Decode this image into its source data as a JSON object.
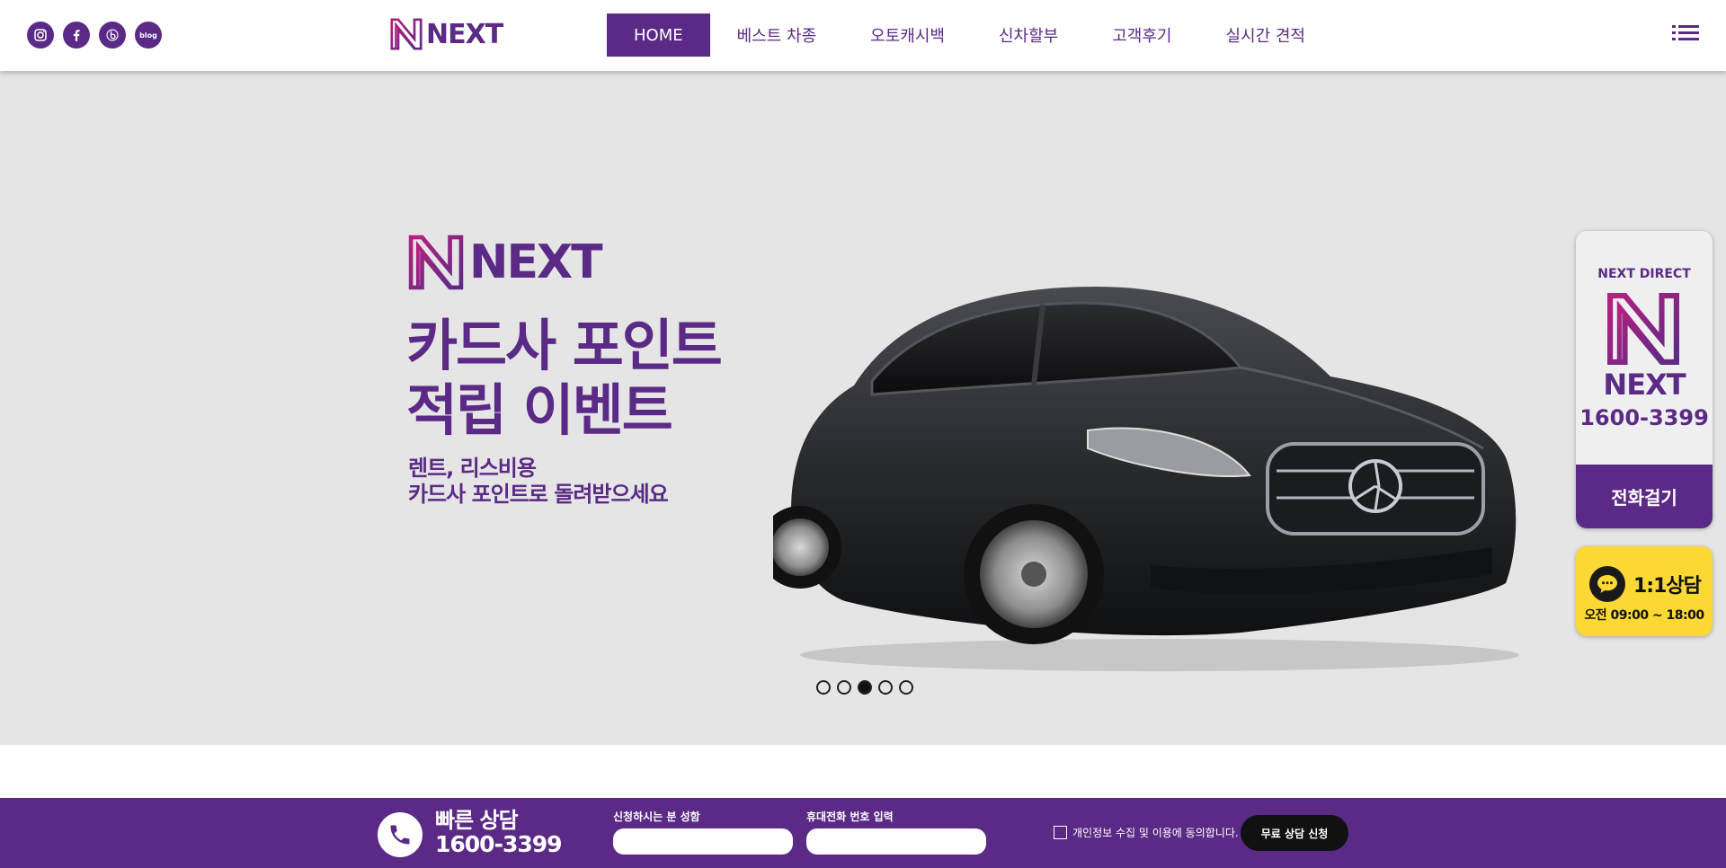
{
  "header": {
    "socials": [
      {
        "icon": "instagram-icon"
      },
      {
        "icon": "facebook-icon"
      },
      {
        "icon": "band-icon"
      },
      {
        "icon": "blog-icon",
        "label": "blog"
      }
    ],
    "logo_text": "NEXT",
    "nav": [
      {
        "label": "HOME",
        "active": true
      },
      {
        "label": "베스트 차종",
        "active": false
      },
      {
        "label": "오토캐시백",
        "active": false
      },
      {
        "label": "신차할부",
        "active": false
      },
      {
        "label": "고객후기",
        "active": false
      },
      {
        "label": "실시간 견적",
        "active": false
      }
    ],
    "menu_icon": "hamburger-menu-icon"
  },
  "hero": {
    "logo_text": "NEXT",
    "title_line1": "카드사 포인트",
    "title_line2": "적립 이벤트",
    "sub_line1": "렌트, 리스비용",
    "sub_line2": "카드사 포인트로 돌려받으세요",
    "slides_total": 5,
    "active_slide": 3
  },
  "call_widget": {
    "label": "NEXT DIRECT",
    "name": "NEXT",
    "phone": "1600-3399",
    "button": "전화걸기"
  },
  "chat_widget": {
    "title": "1:1상담",
    "hours": "오전 09:00 ~ 18:00"
  },
  "bottom_bar": {
    "title": "빠른 상담",
    "number": "1600-3399",
    "name_label": "신청하시는 분 성함",
    "phone_label": "휴대전화 번호 입력",
    "name_value": "",
    "phone_value": "",
    "consent": "개인정보 수집 및 이용에 동의합니다.",
    "submit": "무료 상담 신청"
  },
  "colors": {
    "brand": "#5b2a86",
    "hero_bg": "#e5e5e5",
    "chat": "#fbd833"
  }
}
